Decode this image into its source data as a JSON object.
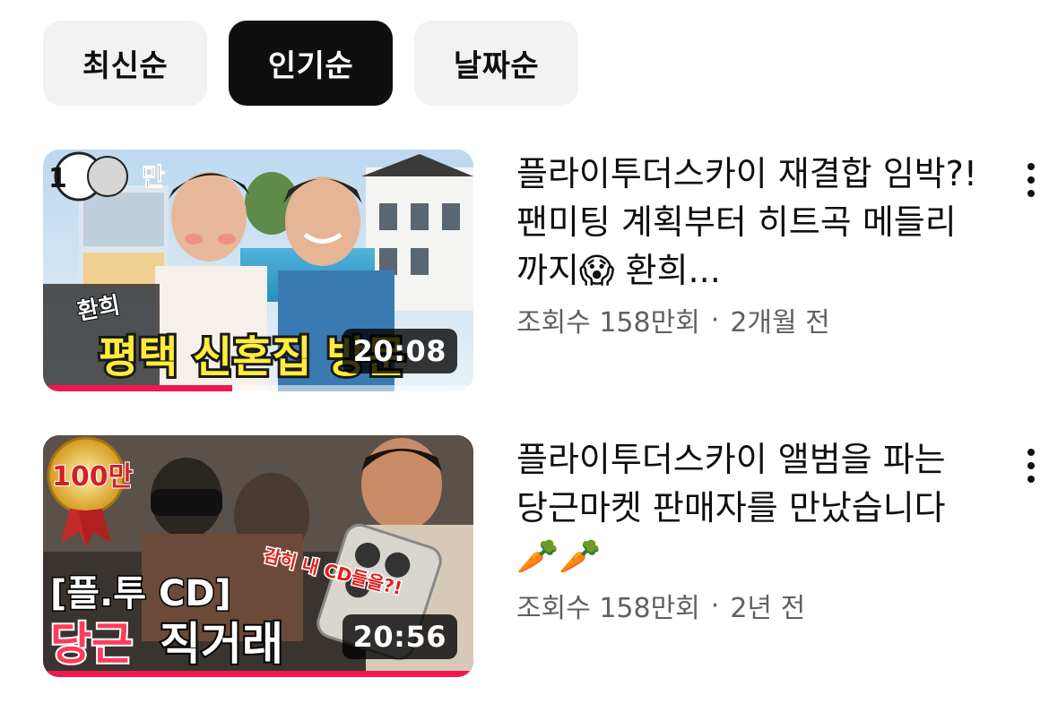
{
  "chips": [
    {
      "label": "최신순",
      "active": false
    },
    {
      "label": "인기순",
      "active": true
    },
    {
      "label": "날짜순",
      "active": false
    }
  ],
  "videos": [
    {
      "title": "플라이투더스카이 재결합 임박?! 팬미팅 계획부터 히트곡 메들리까지😱 환희...",
      "views": "조회수 158만회",
      "separator": "·",
      "age": "2개월 전",
      "duration": "20:08",
      "progress_pct": 44,
      "thumb": {
        "badge": "100만",
        "caption_small": "환희",
        "caption_main": "평택 신혼집 방문"
      }
    },
    {
      "title": "플라이투더스카이 앨범을 파는 당근마켓 판매자를 만났습니다 🥕🥕",
      "views": "조회수 158만회",
      "separator": "·",
      "age": "2년 전",
      "duration": "20:56",
      "progress_pct": 100,
      "thumb": {
        "badge": "100만",
        "caption_bubble": "감히 내 CD들을?!",
        "caption_top": "[플.투 CD]",
        "caption_bottom_a": "당근",
        "caption_bottom_b": "직거래"
      }
    }
  ]
}
